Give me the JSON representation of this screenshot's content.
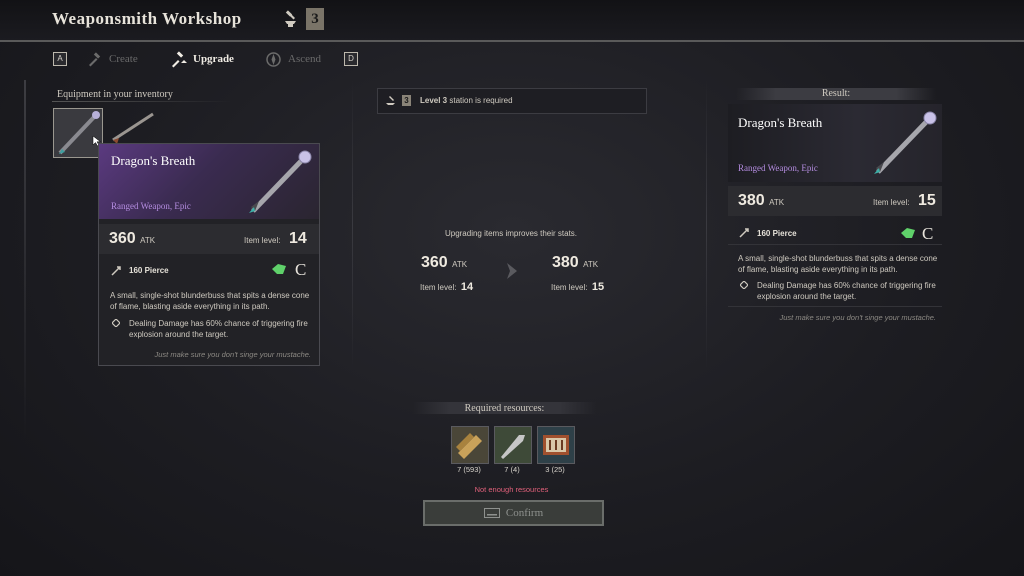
{
  "header": {
    "title": "Weaponsmith Workshop",
    "station_level": "3"
  },
  "tabs": {
    "left_key": "A",
    "right_key": "D",
    "items": [
      {
        "label": "Create",
        "icon": "hammer-icon",
        "active": false
      },
      {
        "label": "Upgrade",
        "icon": "upgrade-hammer-icon",
        "active": true
      },
      {
        "label": "Ascend",
        "icon": "ascend-sigil-icon",
        "active": false
      }
    ]
  },
  "inventory": {
    "label": "Equipment in your inventory"
  },
  "item": {
    "name": "Dragon's Breath",
    "type": "Ranged Weapon, Epic",
    "atk": "360",
    "atk_unit": "ATK",
    "item_level_label": "Item level:",
    "item_level": "14",
    "pierce": "160 Pierce",
    "grade": "C",
    "description": "A small, single-shot blunderbuss that spits a dense cone of flame, blasting aside everything in its path.",
    "effect": "Dealing Damage has 60% chance of triggering fire explosion around the target.",
    "flavor": "Just make sure you don't singe your mustache."
  },
  "requirement": {
    "level": "3",
    "text_bold": "Level 3",
    "text_rest": "station is required"
  },
  "upgrade_info": {
    "text": "Upgrading items improves their stats.",
    "from_atk": "360",
    "from_level": "14",
    "to_atk": "380",
    "to_level": "15",
    "atk_unit": "ATK",
    "level_label": "Item level:"
  },
  "resources": {
    "label": "Required resources:",
    "items": [
      {
        "icon": "wood-logs-icon",
        "count": "7",
        "owned": "(593)"
      },
      {
        "icon": "metal-blade-icon",
        "count": "7",
        "owned": "(4)"
      },
      {
        "icon": "toolbox-icon",
        "count": "3",
        "owned": "(25)"
      }
    ],
    "warning": "Not enough resources"
  },
  "confirm": {
    "label": "Confirm"
  },
  "result": {
    "label": "Result:",
    "name": "Dragon's Breath",
    "type": "Ranged Weapon, Epic",
    "atk": "380",
    "atk_unit": "ATK",
    "item_level_label": "Item level:",
    "item_level": "15",
    "pierce": "160 Pierce",
    "grade": "C",
    "description": "A small, single-shot blunderbuss that spits a dense cone of flame, blasting aside everything in its path.",
    "effect": "Dealing Damage has 60% chance of triggering fire explosion around the target.",
    "flavor": "Just make sure you don't singe your mustache."
  },
  "colors": {
    "epic": "#b48ce0",
    "warning": "#e0607a",
    "accent_green": "#5fd16a"
  }
}
